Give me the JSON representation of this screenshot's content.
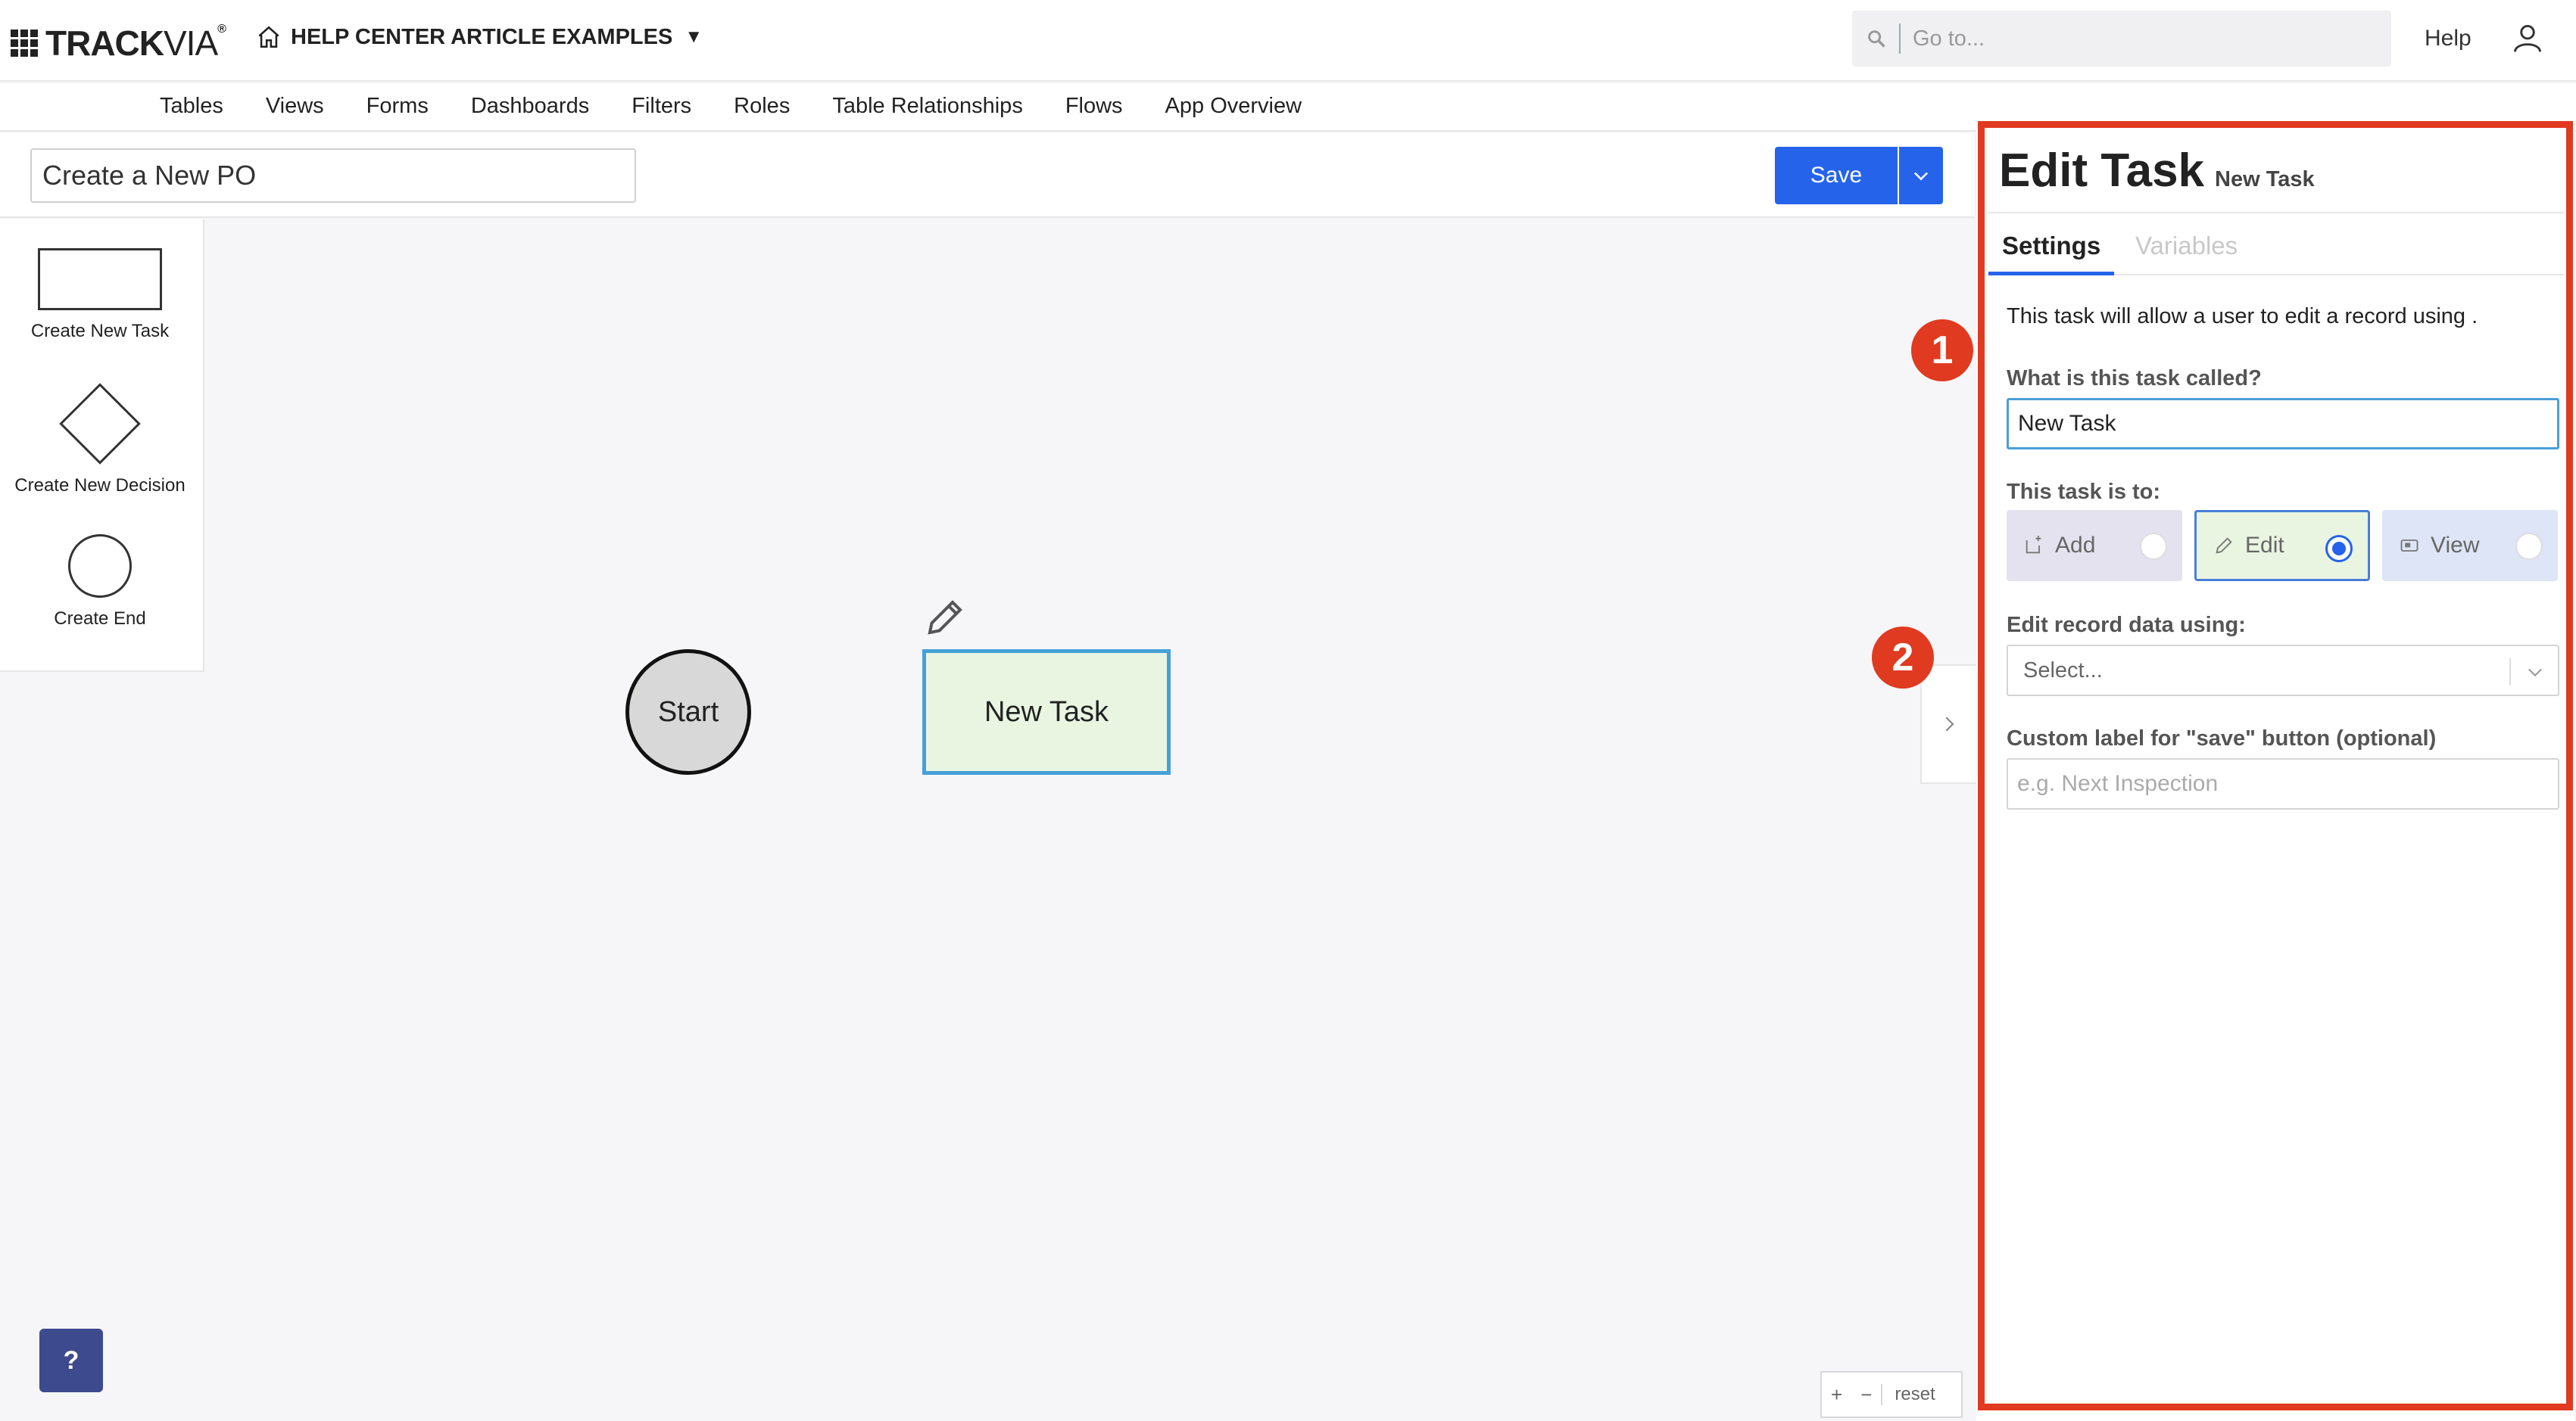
{
  "header": {
    "logo_bold": "TRACK",
    "logo_light": "VIA",
    "logo_mark": "®",
    "app_name": "HELP CENTER ARTICLE EXAMPLES",
    "app_caret": "▼",
    "search_placeholder": "Go to...",
    "help_label": "Help"
  },
  "nav": {
    "items": [
      "Tables",
      "Views",
      "Forms",
      "Dashboards",
      "Filters",
      "Roles",
      "Table Relationships",
      "Flows",
      "App Overview"
    ]
  },
  "flow": {
    "name": "Create a New PO",
    "save_label": "Save"
  },
  "palette": {
    "task_label": "Create New Task",
    "decision_label": "Create New Decision",
    "end_label": "Create End"
  },
  "canvas": {
    "start_label": "Start",
    "task_label": "New Task",
    "zoom_in": "+",
    "zoom_out": "−",
    "reset_label": "reset",
    "help_fab": "?"
  },
  "callouts": [
    "1",
    "2"
  ],
  "panel": {
    "title": "Edit Task",
    "subtitle": "New Task",
    "tabs": [
      "Settings",
      "Variables"
    ],
    "description": "This task will allow a user to edit a record using .",
    "name_label": "What is this task called?",
    "name_value": "New Task",
    "type_label": "This task is to:",
    "choices": [
      {
        "label": "Add",
        "selected": false
      },
      {
        "label": "Edit",
        "selected": true
      },
      {
        "label": "View",
        "selected": false
      }
    ],
    "record_label": "Edit record data using:",
    "record_placeholder": "Select...",
    "custom_label": "Custom label for \"save\" button (optional)",
    "custom_placeholder": "e.g. Next Inspection"
  },
  "colors": {
    "accent": "#2563eb",
    "highlight": "#e03a20",
    "task_fill": "#e9f5e1",
    "task_border": "#46a0d8"
  }
}
